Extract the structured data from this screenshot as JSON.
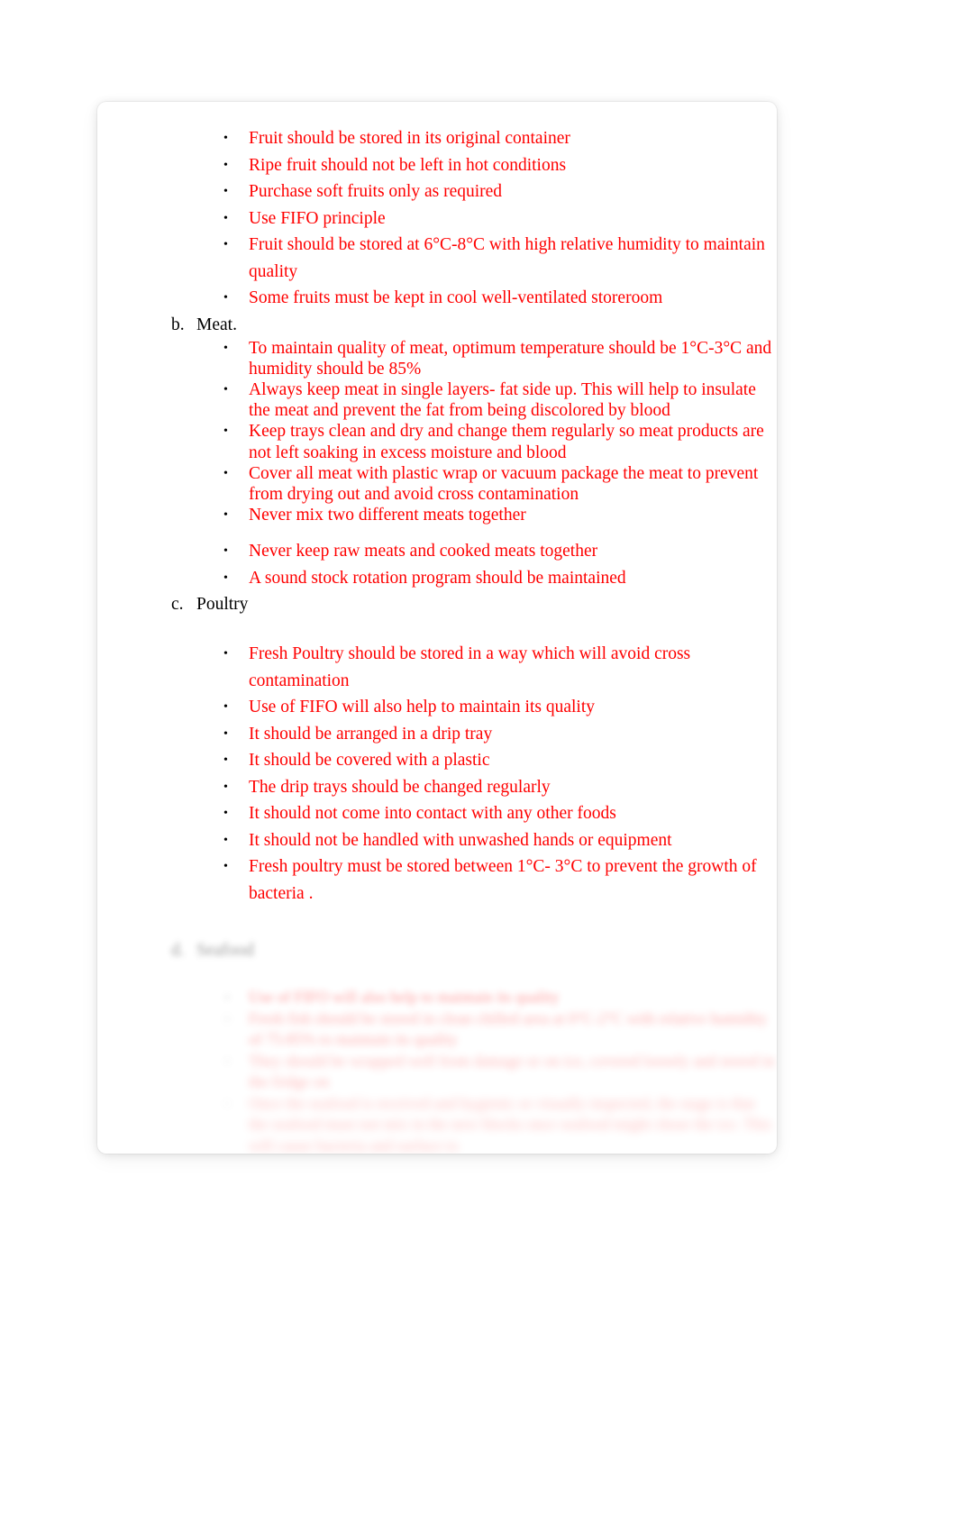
{
  "document": {
    "page_background": "#ffffff",
    "text_color_body": "#ff0000",
    "text_color_heading": "#000000"
  },
  "sections": [
    {
      "id": "fruit",
      "heading": null,
      "heading_marker": null,
      "spacing": "1.5",
      "bullets": [
        "Fruit should be stored in its original container",
        "Ripe fruit should not be left in hot conditions",
        "Purchase soft fruits only as required",
        "Use FIFO principle",
        "Fruit should be stored at 6°C-8°C with high relative humidity to maintain quality",
        "Some fruits must be kept in cool well-ventilated storeroom"
      ]
    },
    {
      "id": "meat",
      "heading": "Meat.",
      "heading_marker": "b.",
      "spacing": "1.0",
      "bullets": [
        "To maintain quality of meat, optimum temperature should be 1°C-3°C and humidity should be 85%",
        "Always keep meat in single layers- fat side up. This will help to insulate the meat and prevent the fat from being discolored by blood",
        "Keep trays clean and dry and change them regularly so meat products are not left soaking in excess moisture and blood",
        "Cover all meat with plastic wrap or vacuum package the meat to prevent from drying out and avoid cross contamination",
        "Never mix two different meats together",
        "Never keep raw meats and cooked meats together",
        "A sound stock rotation program should be maintained"
      ]
    },
    {
      "id": "poultry",
      "heading": "Poultry",
      "heading_marker": "c.",
      "spacing": "1.5",
      "bullets": [
        "Fresh Poultry should be stored in a way which will avoid cross contamination",
        "Use of FIFO will also help to maintain its quality",
        "It should be arranged in a drip tray",
        "It should be covered with a plastic",
        "The drip trays should be changed regularly",
        "It should not come into contact with any other foods",
        "It should not be handled with unwashed hands or equipment",
        "Fresh poultry must be stored between 1°C- 3°C to prevent the growth of bacteria ."
      ]
    }
  ],
  "faded_section": {
    "id": "seafood",
    "heading_marker": "d.",
    "heading": "Seafood",
    "legible": false,
    "bullets": [
      "Use of FIFO will also help to maintain its quality",
      "Fresh fish should be stored in clean chilled area at 0°C-2°C with relative humidity of 75-85% to maintain its quality",
      "They should be wrapped well from damage or on ice, covered loosely and stored in the fridge on",
      "Once the seafood is received and hygienic or visually inspected, the stage is that the seafood must not mix in the new blocks once seafood might chose the ice. This will cause bacteria and surface to"
    ]
  }
}
